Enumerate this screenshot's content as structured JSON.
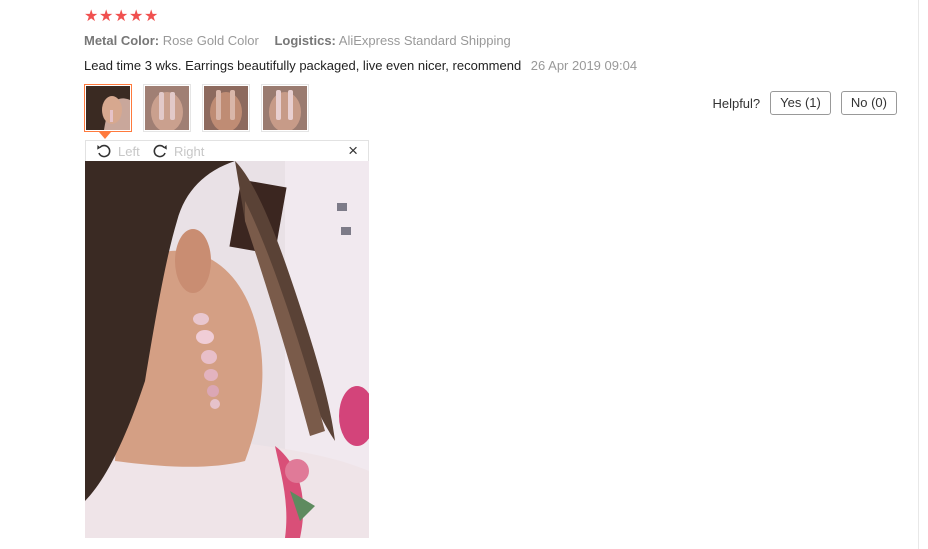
{
  "review": {
    "rating": 5,
    "stars": [
      "★",
      "★",
      "★",
      "★",
      "★"
    ],
    "metal_color_key": "Metal Color:",
    "metal_color_value": "Rose Gold Color",
    "logistics_key": "Logistics:",
    "logistics_value": "AliExpress Standard Shipping",
    "text": "Lead time 3 wks. Earrings beautifully packaged, live even nicer, recommend",
    "date": "26 Apr 2019 09:04"
  },
  "viewer": {
    "rotate_left_label": "Left",
    "rotate_right_label": "Right",
    "close_glyph": "×"
  },
  "helpful": {
    "label": "Helpful?",
    "yes_label": "Yes (1)",
    "no_label": "No (0)"
  },
  "colors": {
    "star": "#f0504f",
    "active_thumb": "#ff7a3d"
  }
}
